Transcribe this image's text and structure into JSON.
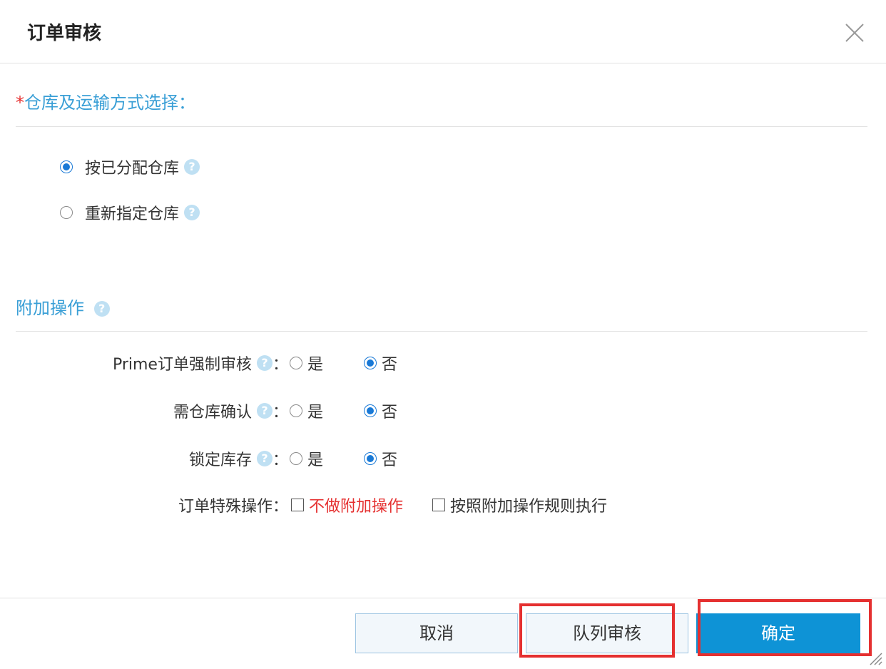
{
  "dialog": {
    "title": "订单审核"
  },
  "warehouse_section": {
    "required_mark": "*",
    "title": "仓库及运输方式选择：",
    "options": [
      {
        "label": "按已分配仓库",
        "selected": true
      },
      {
        "label": "重新指定仓库",
        "selected": false
      }
    ]
  },
  "extra_section": {
    "title": "附加操作",
    "rows": [
      {
        "label": "Prime订单强制审核",
        "colon": "：",
        "yes": "是",
        "no": "否",
        "value": "否"
      },
      {
        "label": "需仓库确认",
        "colon": "：",
        "yes": "是",
        "no": "否",
        "value": "否"
      },
      {
        "label": "锁定库存",
        "colon": "：",
        "yes": "是",
        "no": "否",
        "value": "否"
      }
    ],
    "special": {
      "label": "订单特殊操作：",
      "options": [
        {
          "label": "不做附加操作",
          "checked": false,
          "color": "#e53030"
        },
        {
          "label": "按照附加操作规则执行",
          "checked": false
        }
      ]
    }
  },
  "footer": {
    "cancel_label": "取消",
    "queue_label": "队列审核",
    "confirm_label": "确定"
  },
  "icons": {
    "help": "question-circle-icon",
    "close": "close-x-icon"
  },
  "colors": {
    "accent": "#3a9fd6",
    "primary_button": "#0e93d6",
    "required": "#e53030",
    "highlight_box": "#e53030"
  }
}
